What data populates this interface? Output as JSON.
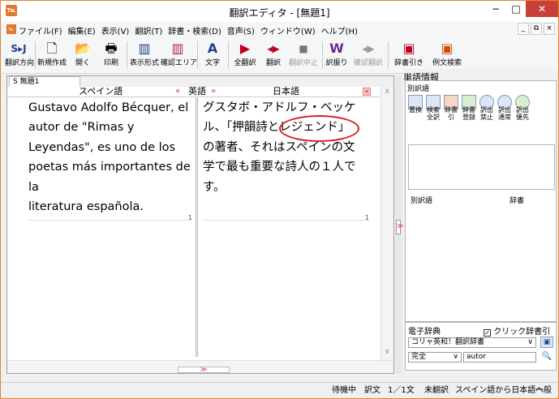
{
  "window": {
    "title": "翻訳エディタ - [無題1]",
    "app_icon_glyph": "℡",
    "controls": {
      "min": "−",
      "max": "□",
      "close": "✕"
    }
  },
  "menu": {
    "items": [
      "ファイル(F)",
      "編集(E)",
      "表示(V)",
      "翻訳(T)",
      "辞書・検索(D)",
      "音声(S)",
      "ウィンドウ(W)",
      "ヘルプ(H)"
    ],
    "mdi": {
      "min": "_",
      "restore": "⧉",
      "close": "×"
    }
  },
  "toolbar": {
    "buttons": [
      {
        "label": "翻訳方向",
        "glyph": "S▸J",
        "icon": "direction-icon",
        "color": "#1f3f8f",
        "enabled": true
      },
      {
        "label": "新規作成",
        "glyph": "🗋",
        "icon": "new-document-icon",
        "color": "#444444",
        "enabled": true
      },
      {
        "label": "開く",
        "glyph": "📂",
        "icon": "open-folder-icon",
        "color": "#444444",
        "enabled": true
      },
      {
        "label": "印刷",
        "glyph": "🖶",
        "icon": "print-icon",
        "color": "#444444",
        "enabled": true
      },
      {
        "label": "表示形式",
        "glyph": "▥",
        "icon": "display-format-icon",
        "color": "#1f3f8f",
        "enabled": true
      },
      {
        "label": "確認エリア",
        "glyph": "▥",
        "icon": "confirm-area-icon",
        "color": "#b21f4f",
        "enabled": true
      },
      {
        "label": "文字",
        "glyph": "A",
        "icon": "font-icon",
        "color": "#1f3f8f",
        "enabled": true
      },
      {
        "label": "全翻訳",
        "glyph": "▶",
        "icon": "translate-all-icon",
        "color": "#c0001f",
        "enabled": true
      },
      {
        "label": "翻訳",
        "glyph": "◂▶",
        "icon": "translate-icon",
        "color": "#c0001f",
        "enabled": true
      },
      {
        "label": "翻訳中止",
        "glyph": "■",
        "icon": "stop-icon",
        "color": "#777777",
        "enabled": false
      },
      {
        "label": "訳振り",
        "glyph": "W",
        "icon": "ruby-translation-icon",
        "color": "#6a2b8f",
        "enabled": true
      },
      {
        "label": "確認翻訳",
        "glyph": "◂▶",
        "icon": "confirm-translation-icon",
        "color": "#999999",
        "enabled": false
      },
      {
        "label": "辞書引き",
        "glyph": "▣",
        "icon": "dictionary-lookup-icon",
        "color": "#c0001f",
        "enabled": true
      },
      {
        "label": "例文検索",
        "glyph": "▣",
        "icon": "example-search-icon",
        "color": "#d14b00",
        "enabled": true
      }
    ]
  },
  "editor": {
    "tab": "S  無題1",
    "source_header": "スペイン語",
    "middle_header": "英語",
    "target_header": "日本語",
    "chev_left": "«",
    "chev_right": "»",
    "source_text": "Gustavo Adolfo Bécquer, el\nautor de \"Rimas y\nLeyendas\", es uno de los\npoetas más importantes de\nla\nliteratura española.",
    "target_text": "グスタボ・アドルフ・ベッケ\nル、「押韻詩とレジェンド」\nの著者、それはスペインの文\n学で最も重要な詩人の１人で\nす。",
    "source_line_no": "1",
    "target_line_no": "1",
    "hscroll_mark": "≫",
    "split_mark": "≫",
    "scroll_up": "∧",
    "scroll_down": "∨",
    "highlight_color": "#d21f1f"
  },
  "word_info": {
    "title": "単語情報",
    "section_heading": "別訳語",
    "icon_labels": [
      "置換",
      "検索\n全訳",
      "辞書引",
      "辞書\n登録",
      "訳出\n禁止",
      "訳出\n通常",
      "訳出\n優先"
    ],
    "alt_word_label": "別訳語",
    "dict_label": "辞書"
  },
  "e_dict": {
    "title": "電子辞典",
    "click_lookup": "クリック辞書引",
    "click_lookup_checked": true,
    "check_glyph": "✓",
    "dictionary": "コリャ英和！翻訳辞書",
    "match_mode": "完全",
    "search_value": "autor",
    "dropdown_glyph": "∨",
    "search_glyph": "🔍",
    "book_glyph": "▣"
  },
  "status": {
    "state": "待機中",
    "mode": "訳文",
    "position": "1／1文",
    "untranslated": "未翻訳",
    "direction": "スペイン語から日本語へ",
    "dict_mode": "一般"
  }
}
